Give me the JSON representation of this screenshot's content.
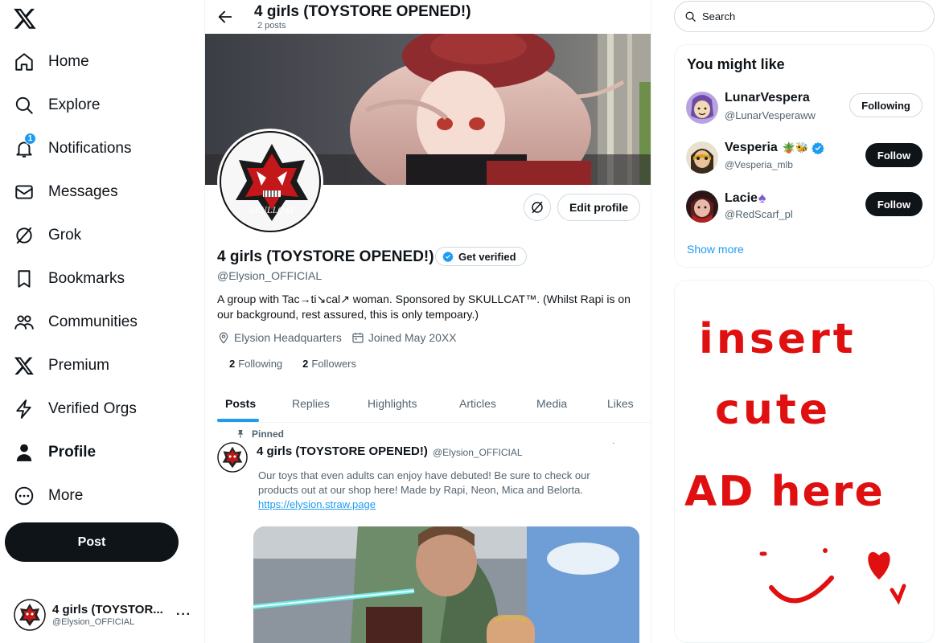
{
  "nav": {
    "items": [
      {
        "label": "Home",
        "icon": "home-icon"
      },
      {
        "label": "Explore",
        "icon": "search-icon"
      },
      {
        "label": "Notifications",
        "icon": "bell-icon",
        "badge": "1"
      },
      {
        "label": "Messages",
        "icon": "envelope-icon"
      },
      {
        "label": "Grok",
        "icon": "grok-icon"
      },
      {
        "label": "Bookmarks",
        "icon": "bookmark-icon"
      },
      {
        "label": "Communities",
        "icon": "people-icon"
      },
      {
        "label": "Premium",
        "icon": "x-logo-icon"
      },
      {
        "label": "Verified Orgs",
        "icon": "lightning-icon"
      },
      {
        "label": "Profile",
        "icon": "person-icon",
        "active": true
      },
      {
        "label": "More",
        "icon": "more-circle-icon"
      }
    ],
    "post_label": "Post",
    "account": {
      "name": "4 girls (TOYSTOR...",
      "handle": "@Elysion_OFFICIAL",
      "more": "···"
    }
  },
  "header": {
    "title": "4 girls (TOYSTORE OPENED!)",
    "subtitle": "2 posts"
  },
  "profile": {
    "name": "4 girls (TOYSTORE OPENED!)",
    "get_verified": "Get verified",
    "handle": "@Elysion_OFFICIAL",
    "bio": "A group with Tac→ti↘cal↗ woman. Sponsored by SKULLCAT™. (Whilst Rapi is on our background, rest assured, this is only tempoary.)",
    "location": "Elysion Headquarters",
    "joined": "Joined May 20XX",
    "following_count": "2",
    "following_label": "Following",
    "followers_count": "2",
    "followers_label": "Followers",
    "edit_label": "Edit profile",
    "avatar_text": "SKULLCAT"
  },
  "tabs": [
    {
      "label": "Posts",
      "active": true
    },
    {
      "label": "Replies"
    },
    {
      "label": "Highlights"
    },
    {
      "label": "Articles"
    },
    {
      "label": "Media"
    },
    {
      "label": "Likes"
    }
  ],
  "tweet": {
    "pinned": "Pinned",
    "name": "4 girls (TOYSTORE OPENED!)",
    "handle": "@Elysion_OFFICIAL",
    "dots": "·",
    "text": "Our toys that even adults can enjoy have debuted! Be sure to check our products out at our shop here! Made by Rapi, Neon, Mica and Belorta.",
    "link": "https://elysion.straw.page"
  },
  "search": {
    "placeholder": "Search"
  },
  "suggestions": {
    "title": "You might like",
    "items": [
      {
        "name": "LunarVespera",
        "handle": "@LunarVesperaww",
        "button": "Following",
        "emoji": ""
      },
      {
        "name": "Vesperia",
        "handle": "@Vesperia_mlb",
        "button": "Follow",
        "emoji": "🪴🐝"
      },
      {
        "name": "Lacie",
        "handle": "@RedScarf_pl",
        "button": "Follow",
        "emoji": "♠"
      }
    ],
    "show_more": "Show more"
  },
  "ad": {
    "line1": "insert",
    "line2": "cute",
    "line3": "AD here"
  },
  "colors": {
    "accent": "#1d9bf0",
    "text": "#0f1419",
    "muted": "#536471",
    "ad_ink": "#e01010"
  }
}
